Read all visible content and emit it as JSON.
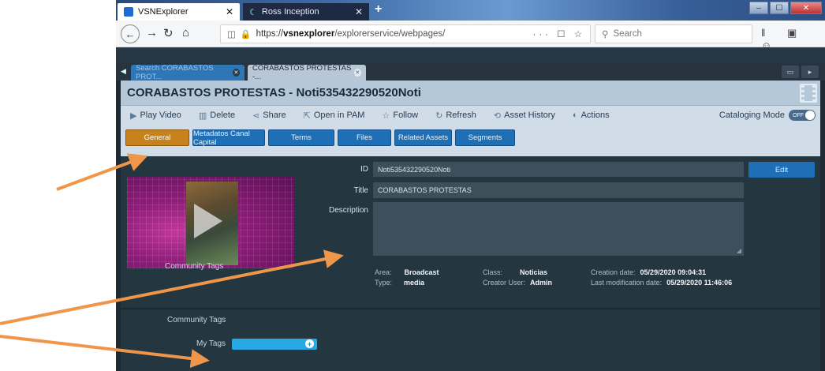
{
  "browser": {
    "tabs": [
      {
        "label": "VSNExplorer",
        "close": "✕"
      },
      {
        "label": "Ross Inception",
        "close": "✕"
      }
    ],
    "new_tab": "+",
    "url": {
      "prefix": "https://",
      "host": "vsnexplorer",
      "path": "/explorerservice/webpages/",
      "icons": "··· ☐ ☆"
    },
    "search_placeholder": "Search"
  },
  "app": {
    "tabs": [
      {
        "label": "Search CORABASTOS PROT..."
      },
      {
        "label": "CORABASTOS PROTESTAS -..."
      }
    ],
    "asset_title": "CORABASTOS PROTESTAS - Noti535432290520Noti",
    "toolbar": {
      "play": "Play Video",
      "delete": "Delete",
      "share": "Share",
      "open_pam": "Open in PAM",
      "follow": "Follow",
      "refresh": "Refresh",
      "history": "Asset History",
      "actions": "Actions",
      "cataloging_mode": "Cataloging Mode",
      "toggle": "OFF"
    },
    "subtabs": [
      "General",
      "Metadatos Canal Capital",
      "Terms",
      "Files",
      "Related Assets",
      "Segments"
    ],
    "fields": {
      "id_label": "ID",
      "id_value": "Noti535432290520Noti",
      "title_label": "Title",
      "title_value": "CORABASTOS PROTESTAS",
      "description_label": "Description",
      "description_value": ""
    },
    "edit": "Edit",
    "meta": {
      "area_label": "Area:",
      "area_value": "Broadcast",
      "type_label": "Type:",
      "type_value": "media",
      "class_label": "Class:",
      "class_value": "Noticias",
      "creator_label": "Creator User:",
      "creator_value": "Admin",
      "created_label": "Creation date:",
      "created_value": "05/29/2020 09:04:31",
      "modified_label": "Last modification date:",
      "modified_value": "05/29/2020 11:46:06"
    },
    "community_tags": "Community Tags",
    "my_tags": "My Tags"
  },
  "colors": {
    "arrow": "#f0964a",
    "general_tab": "#c6831d",
    "tab_blue": "#1f6fb7"
  }
}
